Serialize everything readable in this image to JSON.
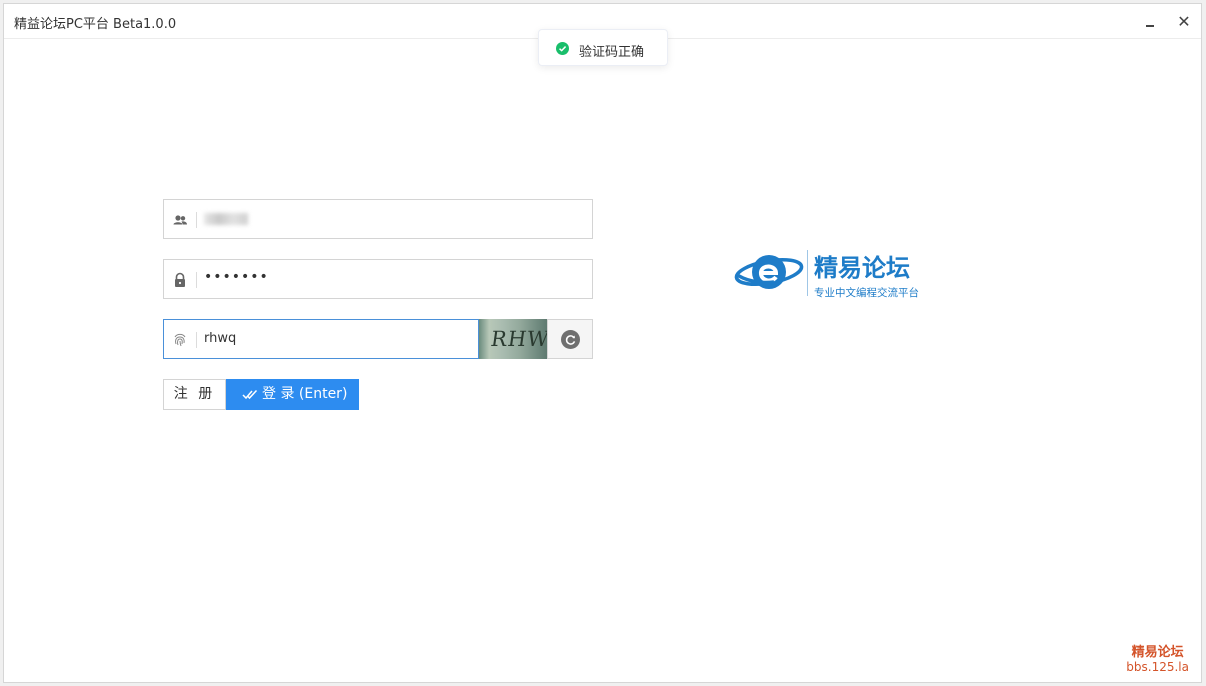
{
  "window": {
    "title": "精益论坛PC平台 Beta1.0.0",
    "minimize_icon": "minimize-icon",
    "close_icon": "close-icon",
    "close_glyph": "✕"
  },
  "toast": {
    "icon": "success-check-icon",
    "message": "验证码正确",
    "color": "#19be6b"
  },
  "form": {
    "username": {
      "icon": "user-group-icon",
      "value": ""
    },
    "password": {
      "icon": "lock-icon",
      "value": "•••••••"
    },
    "captcha": {
      "icon": "fingerprint-icon",
      "value": "rhwq",
      "image_text": "RHWQ"
    },
    "refresh_icon": "refresh-icon",
    "register_label": "注 册",
    "login_label": "登 录 (Enter)",
    "login_icon": "double-check-icon"
  },
  "logo": {
    "name": "精易论坛",
    "slogan": "专业中文编程交流平台"
  },
  "watermark": {
    "name": "精易论坛",
    "url": "bbs.125.la"
  },
  "colors": {
    "primary": "#2d8cf0",
    "brand": "#1e7cc8",
    "focus_border": "#4a90d9",
    "watermark": "#d4542a"
  }
}
